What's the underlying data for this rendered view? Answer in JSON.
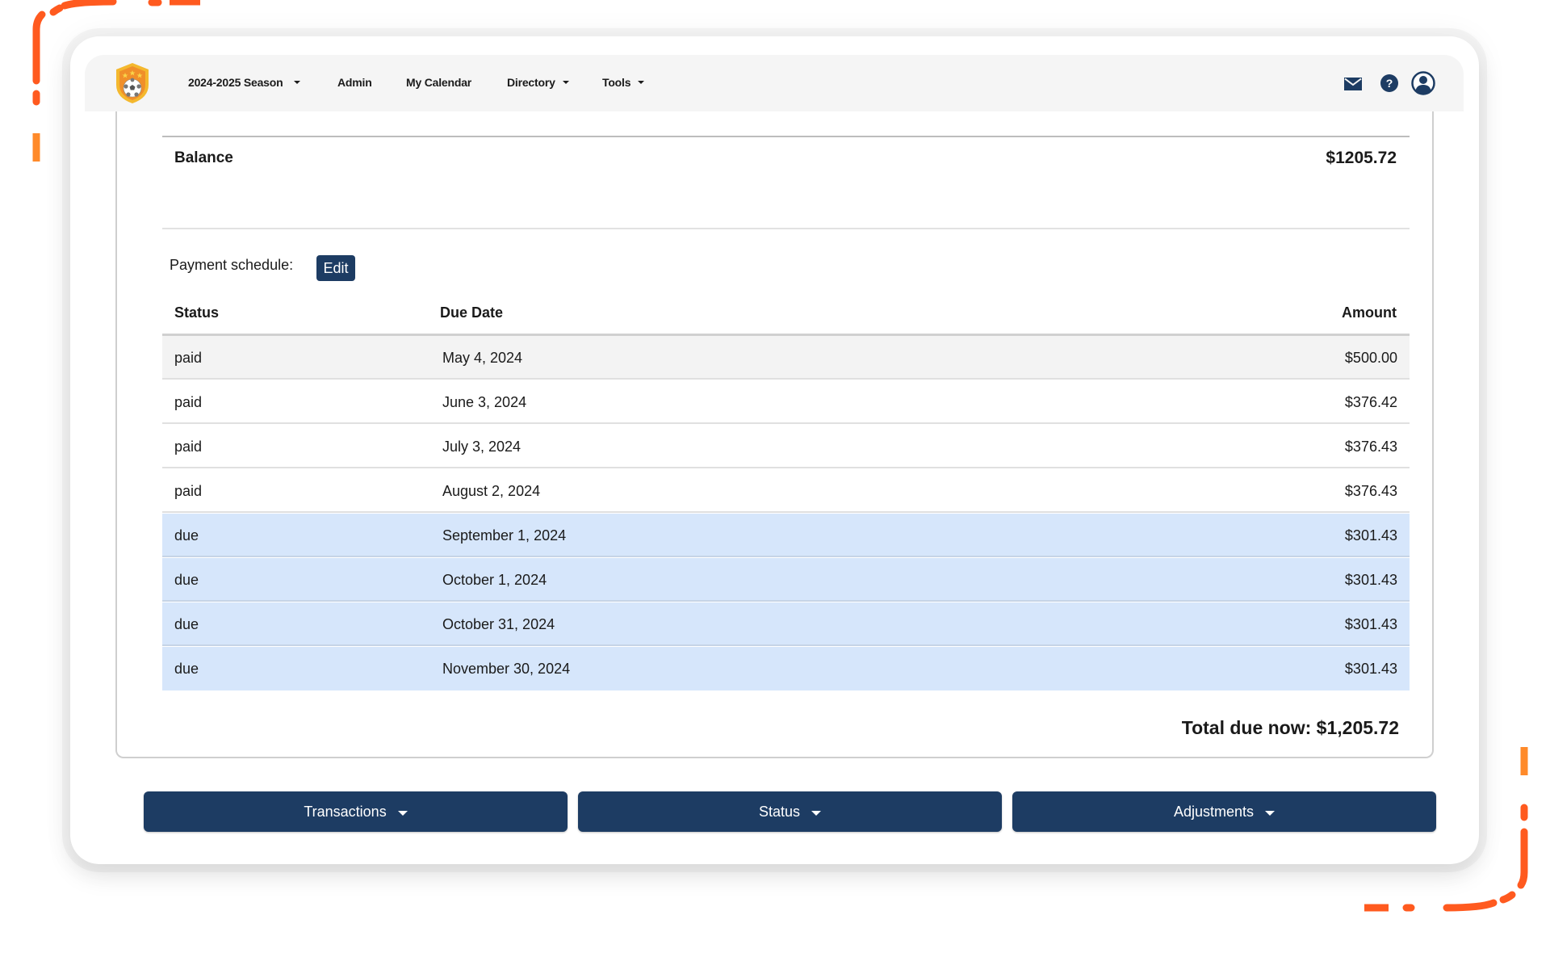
{
  "colors": {
    "accent": "#1d3c63",
    "decoration_orange": "#ff5a1f",
    "due_row_bg": "#d6e6fb",
    "first_row_bg": "#f3f3f3",
    "nav_bg": "#f5f5f5"
  },
  "nav": {
    "logo": "soccer-shield-logo",
    "items": [
      {
        "label": "2024-2025 Season",
        "dropdown": true
      },
      {
        "label": "Admin",
        "dropdown": false
      },
      {
        "label": "My Calendar",
        "dropdown": false
      },
      {
        "label": "Directory",
        "dropdown": true
      },
      {
        "label": "Tools",
        "dropdown": true
      }
    ],
    "icons": [
      "mail-icon",
      "help-icon",
      "user-account-icon"
    ]
  },
  "balance": {
    "label": "Balance",
    "value": "$1205.72"
  },
  "payment_schedule": {
    "label": "Payment schedule:",
    "edit_label": "Edit",
    "columns": [
      "Status",
      "Due Date",
      "Amount"
    ],
    "rows": [
      {
        "status": "paid",
        "due_date": "May 4, 2024",
        "amount": "$500.00"
      },
      {
        "status": "paid",
        "due_date": "June 3, 2024",
        "amount": "$376.42"
      },
      {
        "status": "paid",
        "due_date": "July 3, 2024",
        "amount": "$376.43"
      },
      {
        "status": "paid",
        "due_date": "August 2, 2024",
        "amount": "$376.43"
      },
      {
        "status": "due",
        "due_date": "September 1, 2024",
        "amount": "$301.43"
      },
      {
        "status": "due",
        "due_date": "October 1, 2024",
        "amount": "$301.43"
      },
      {
        "status": "due",
        "due_date": "October 31, 2024",
        "amount": "$301.43"
      },
      {
        "status": "due",
        "due_date": "November 30, 2024",
        "amount": "$301.43"
      }
    ],
    "total_label": "Total due now: $1,205.72"
  },
  "actions": [
    {
      "label": "Transactions"
    },
    {
      "label": "Status"
    },
    {
      "label": "Adjustments"
    }
  ]
}
